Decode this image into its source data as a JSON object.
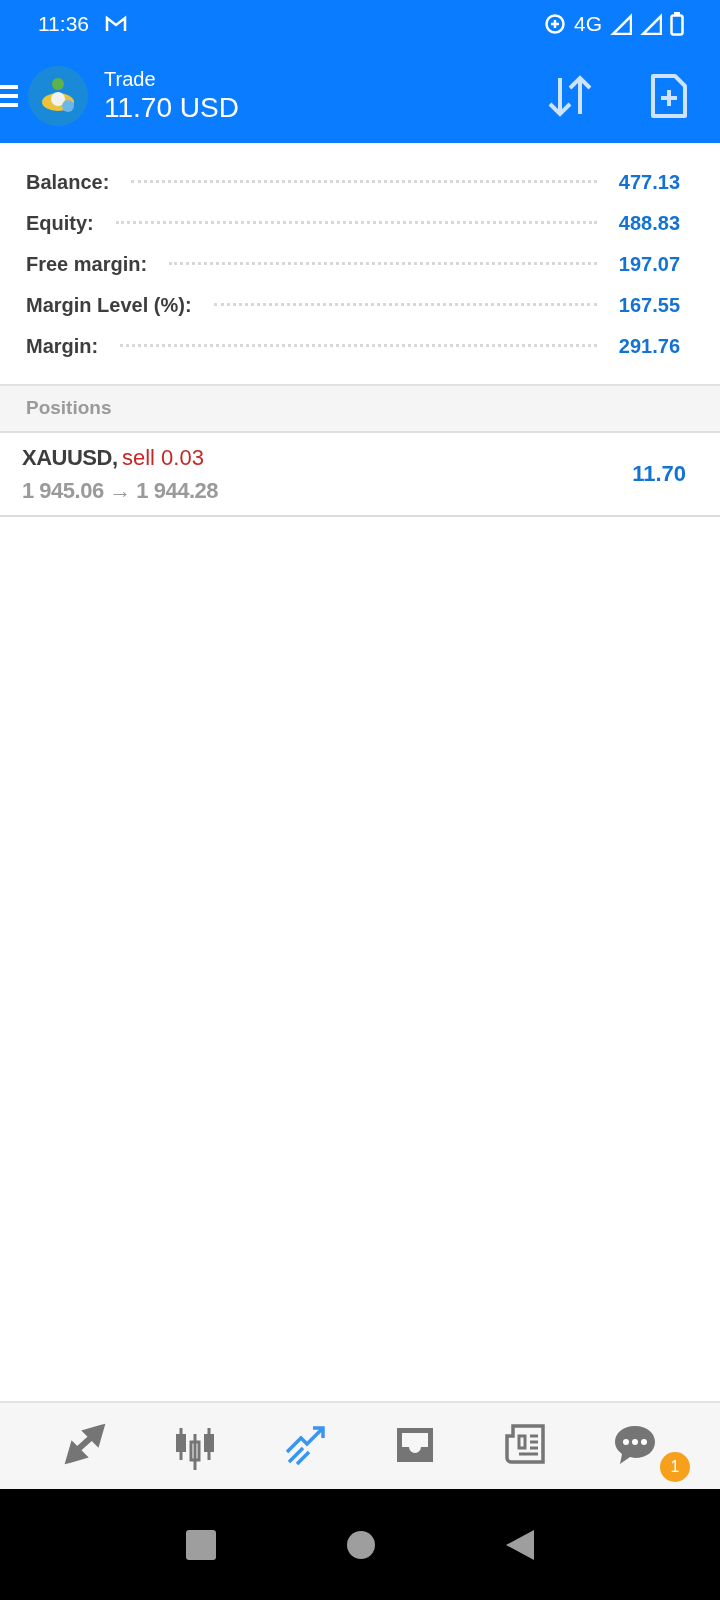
{
  "status_bar": {
    "time": "11:36",
    "network": "4G"
  },
  "header": {
    "title": "Trade",
    "profit": "11.70 USD"
  },
  "account": [
    {
      "label": "Balance:",
      "value": "477.13"
    },
    {
      "label": "Equity:",
      "value": "488.83"
    },
    {
      "label": "Free margin:",
      "value": "197.07"
    },
    {
      "label": "Margin Level (%):",
      "value": "167.55"
    },
    {
      "label": "Margin:",
      "value": "291.76"
    }
  ],
  "positions": {
    "heading": "Positions",
    "items": [
      {
        "symbol": "XAUUSD,",
        "side": "sell 0.03",
        "prices": "1 945.06 → 1 944.28",
        "profit": "11.70"
      }
    ]
  },
  "bottom_nav": [
    {
      "kind": "quotes",
      "selected": false
    },
    {
      "kind": "chart",
      "selected": false
    },
    {
      "kind": "trade",
      "selected": true
    },
    {
      "kind": "history",
      "selected": false
    },
    {
      "kind": "news",
      "selected": false
    },
    {
      "kind": "chat",
      "selected": false,
      "badge": "1"
    }
  ]
}
